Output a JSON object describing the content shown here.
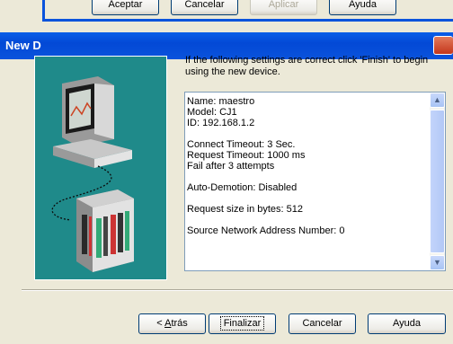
{
  "wizard": {
    "title": "New D",
    "intro_text": "If the following settings are correct click 'Finish' to begin using the new device.",
    "details": [
      "Name: maestro",
      "Model: CJ1",
      "ID: 192.168.1.2",
      "",
      "Connect Timeout: 3 Sec.",
      "Request Timeout: 1000 ms",
      "Fail after 3 attempts",
      "",
      "Auto-Demotion: Disabled",
      "",
      "Request size in bytes: 512",
      "",
      "Source Network Address Number: 0"
    ],
    "buttons": {
      "back_prefix": "< ",
      "back_ul": "A",
      "back_rest": "trás",
      "finish": "Finalizar",
      "cancel": "Cancelar",
      "help": "Ayuda"
    }
  },
  "property_sheet": {
    "buttons": {
      "ok": "Aceptar",
      "cancel": "Cancelar",
      "apply": "Aplicar",
      "help": "Ayuda"
    }
  }
}
